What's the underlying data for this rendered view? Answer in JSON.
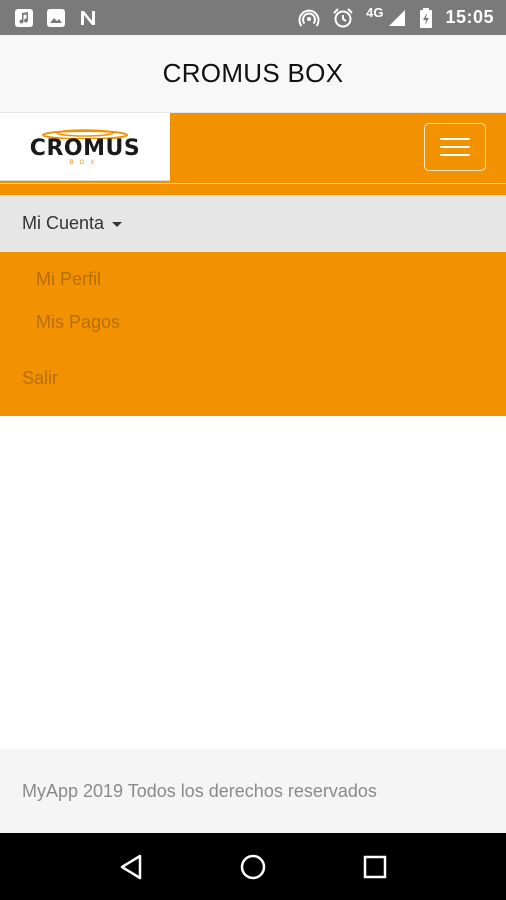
{
  "status_bar": {
    "time": "15:05",
    "network": "4G",
    "icons": [
      "music-note-icon",
      "image-icon",
      "n-notification-icon",
      "hotspot-icon",
      "alarm-icon",
      "signal-icon",
      "battery-icon"
    ]
  },
  "app_bar": {
    "title": "CROMUS BOX"
  },
  "navbar": {
    "brand_name": "CROMUS",
    "brand_sub": "BOX",
    "toggle_icon": "hamburger-menu-icon"
  },
  "menu": {
    "account_label": "Mi Cuenta",
    "items": [
      {
        "label": "Mi Perfil"
      },
      {
        "label": "Mis Pagos"
      }
    ],
    "logout_label": "Salir"
  },
  "footer": {
    "text": "MyApp 2019 Todos los derechos reservados"
  },
  "colors": {
    "accent": "#f39200",
    "menu_link": "#b66e00",
    "dropdown_bg": "#e6e6e6",
    "status_bar": "#7a7a7a",
    "nav_bar": "#000000"
  }
}
